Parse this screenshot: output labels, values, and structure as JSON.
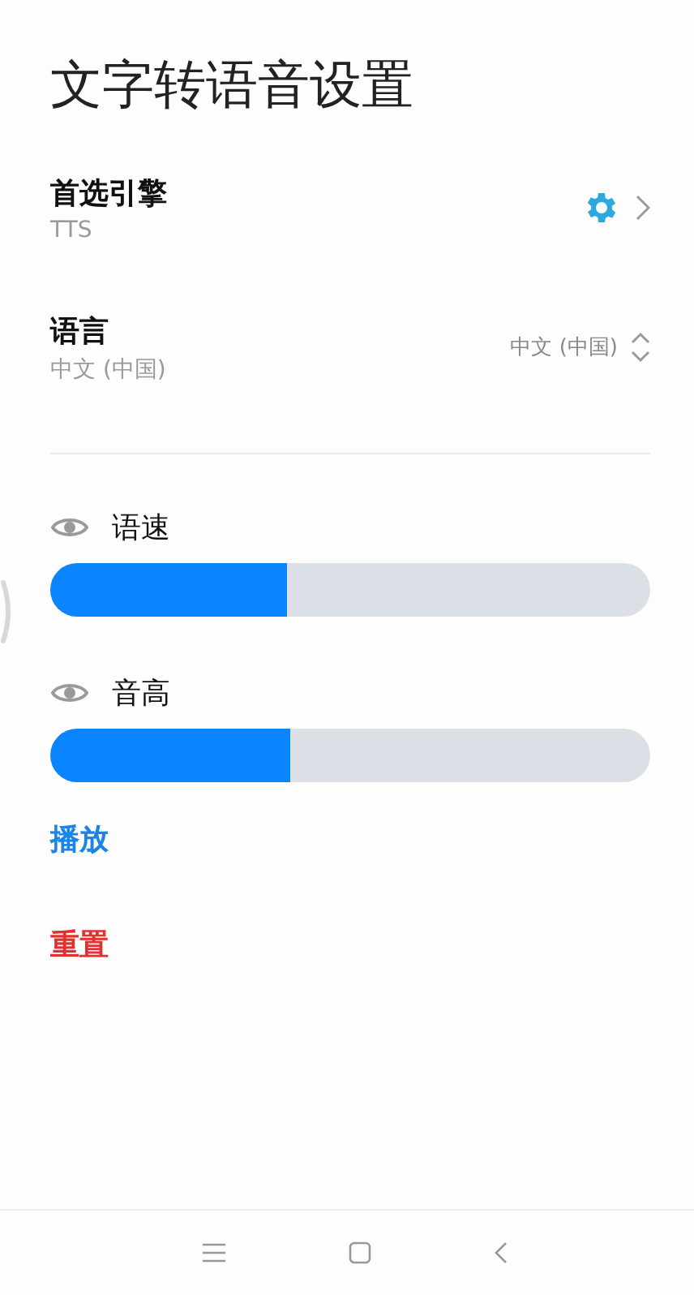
{
  "title": "文字转语音设置",
  "settings": [
    {
      "label": "首选引擎",
      "value": "TTS",
      "kind": "engine"
    },
    {
      "label": "语言",
      "value": "中文 (中国)",
      "kind": "picker",
      "picker_value": "中文 (中国)"
    }
  ],
  "sliders": [
    {
      "label": "语速",
      "level": 0.395
    },
    {
      "label": "音高",
      "level": 0.4
    }
  ],
  "actions": [
    {
      "label": "播放",
      "kind": "primary"
    },
    {
      "label": "重置",
      "kind": "danger"
    }
  ]
}
